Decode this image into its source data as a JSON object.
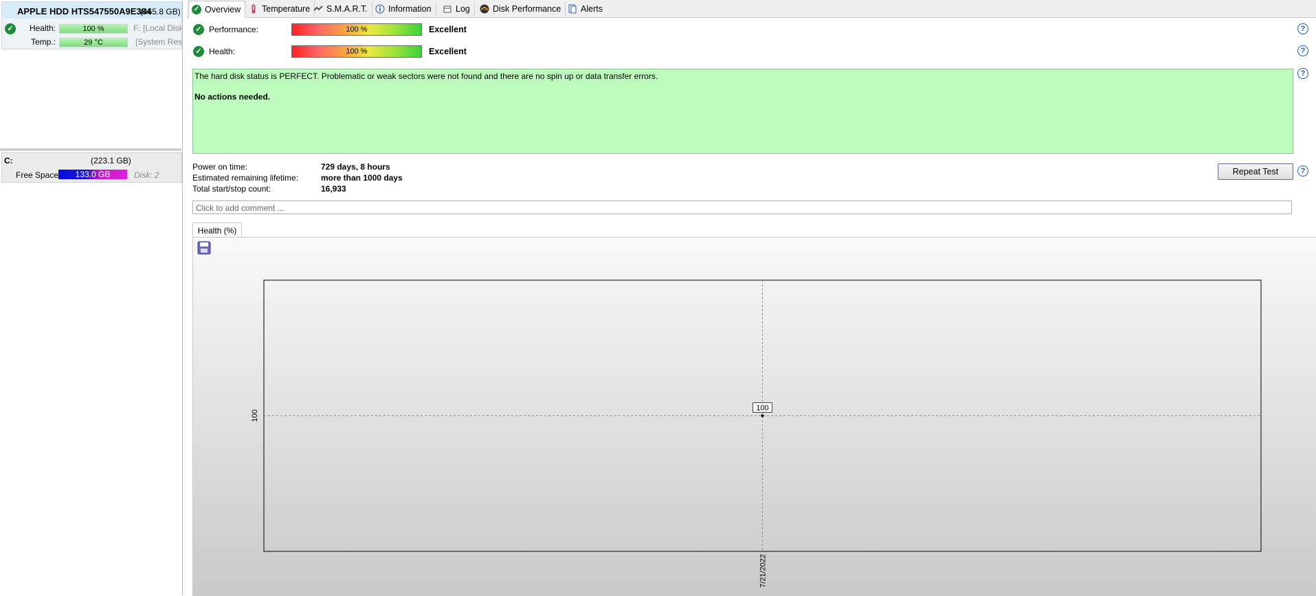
{
  "left_panel": {
    "disk": {
      "title": "APPLE HDD HTS547550A9E384",
      "size": "(465.8 GB)",
      "health_label": "Health:",
      "health_value": "100 %",
      "health_extra": "F: [Local Disk]",
      "temp_label": "Temp.:",
      "temp_value": "29 °C",
      "temp_extra": "[System Rese"
    },
    "volume": {
      "letter": "C:",
      "size": "(223.1 GB)",
      "free_label": "Free Space",
      "free_value": "133.0 GB",
      "free_fraction": 0.6,
      "disk_label": "Disk: 2"
    }
  },
  "tabs": [
    {
      "label": "Overview",
      "icon": "check-icon",
      "active": true
    },
    {
      "label": "Temperature",
      "icon": "thermometer-icon"
    },
    {
      "label": "S.M.A.R.T.",
      "icon": "smart-icon"
    },
    {
      "label": "Information",
      "icon": "info-icon"
    },
    {
      "label": "Log",
      "icon": "log-icon"
    },
    {
      "label": "Disk Performance",
      "icon": "gauge-icon"
    },
    {
      "label": "Alerts",
      "icon": "alerts-icon"
    }
  ],
  "overview": {
    "performance_label": "Performance:",
    "performance_value": "100 %",
    "performance_rating": "Excellent",
    "health_label": "Health:",
    "health_value": "100 %",
    "health_rating": "Excellent",
    "status_text": "The hard disk status is PERFECT. Problematic or weak sectors were not found and there are no spin up or data transfer errors.",
    "actions_text": "No actions needed.",
    "power_on_label": "Power on time:",
    "power_on_value": "729 days, 8 hours",
    "lifetime_label": "Estimated remaining lifetime:",
    "lifetime_value": "more than 1000 days",
    "startstop_label": "Total start/stop count:",
    "startstop_value": "16,933",
    "repeat_button": "Repeat Test",
    "comment_placeholder": "Click to add comment ..."
  },
  "chart_tab_label": "Health (%)",
  "chart_data": {
    "type": "line",
    "x": [
      "7/21/2022"
    ],
    "series": [
      {
        "values": [
          100
        ]
      }
    ],
    "y_tick_labels": [
      "100"
    ],
    "x_tick_labels": [
      "7/21/2022"
    ],
    "data_labels": [
      "100"
    ],
    "grid": true
  },
  "colors": {
    "status_bg": "#bdfcbd",
    "selected_disk_bg": "#d7ecfb",
    "ok_green": "#1f8a3a",
    "help_blue": "#1f5fb5"
  }
}
